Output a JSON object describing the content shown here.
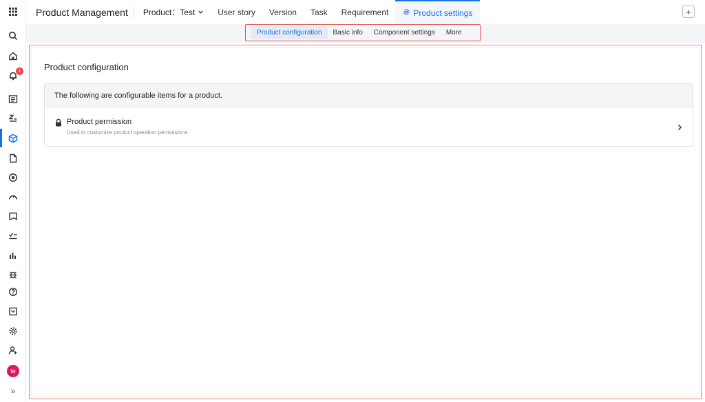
{
  "header": {
    "app_title": "Product Management",
    "product_label": "Product：Test",
    "tabs": [
      {
        "label": "User story"
      },
      {
        "label": "Version"
      },
      {
        "label": "Task"
      },
      {
        "label": "Requirement"
      }
    ],
    "active_tab": "Product settings",
    "add_label": "+"
  },
  "subnav": {
    "tabs": [
      "Product configuration",
      "Basic info",
      "Component settings",
      "More"
    ]
  },
  "sidebar": {
    "notification_count": "1",
    "avatar_initials": "te",
    "expand_label": "»",
    "icons": [
      "apps-grid-icon",
      "search-icon",
      "home-icon",
      "bell-icon",
      "document-list-icon",
      "sort-icon",
      "cube-icon",
      "file-icon",
      "target-icon",
      "dashboard-icon",
      "send-icon",
      "checklist-icon",
      "bar-chart-icon",
      "bug-icon",
      "help-icon",
      "calendar-icon",
      "settings-icon",
      "user-add-icon"
    ]
  },
  "main": {
    "title": "Product configuration",
    "box_header": "The following are configurable items for a product.",
    "items": [
      {
        "title": "Product permission",
        "desc": "Used to customize product operation permissions."
      }
    ]
  },
  "colors": {
    "accent": "#1b6fe0",
    "highlight_border": "#e0584f",
    "badge": "#f04545",
    "avatar": "#d81b60"
  }
}
